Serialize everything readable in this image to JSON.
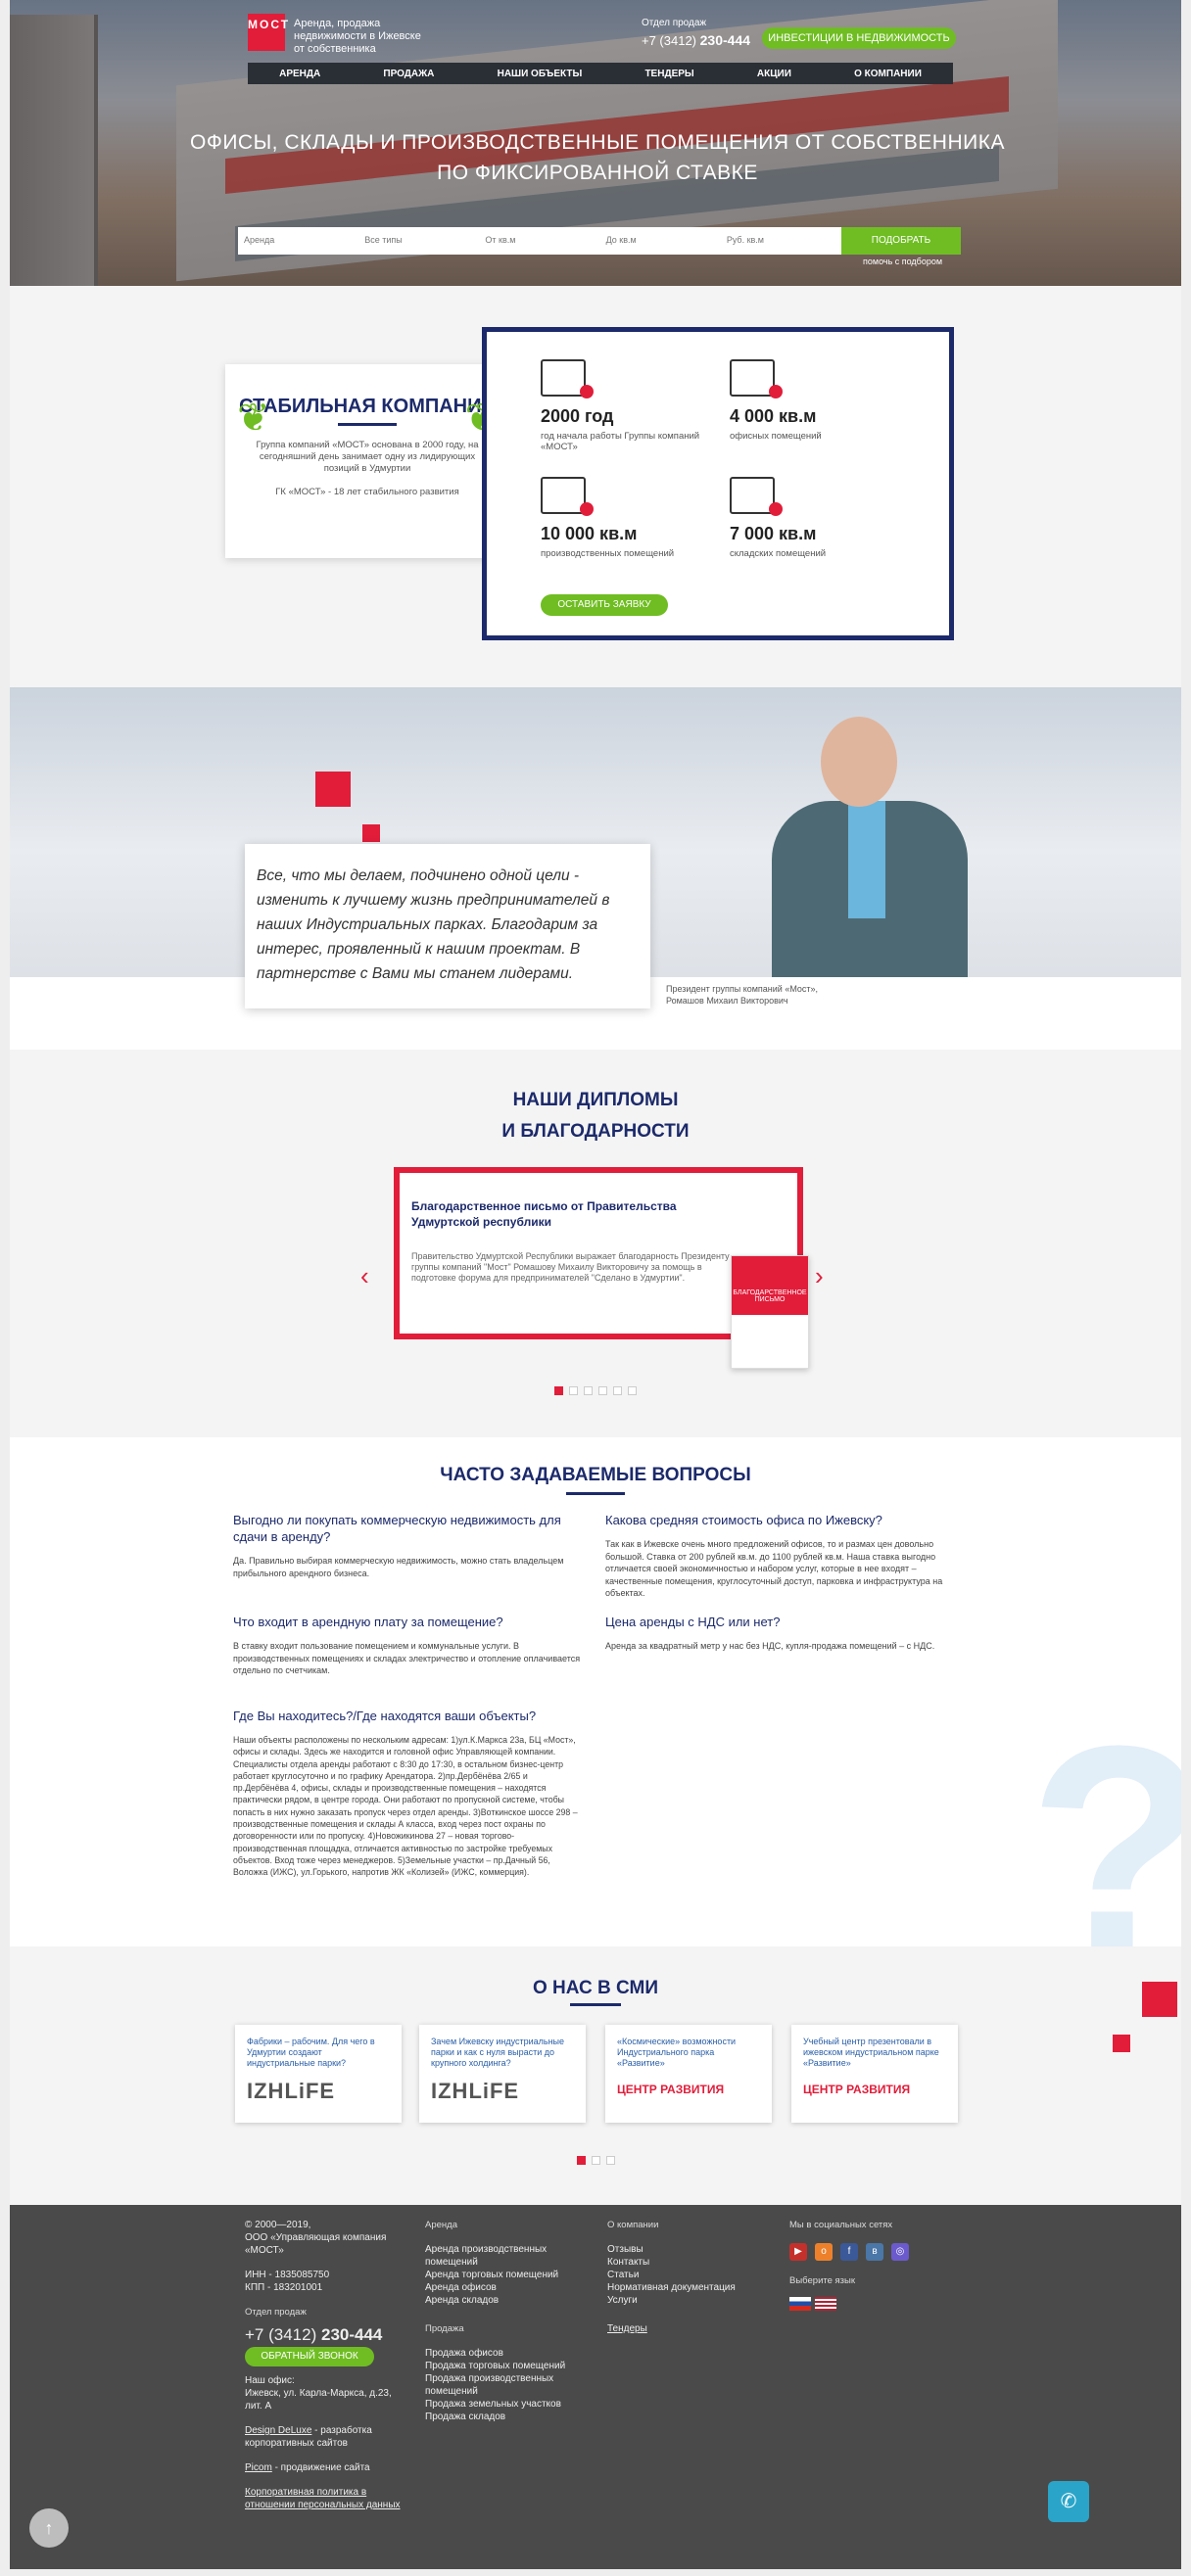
{
  "header": {
    "logo_text": "МОСТ",
    "tagline": "Аренда, продажа недвижимости в Ижевске от собственника",
    "sales_label": "Отдел продаж",
    "phone_prefix": "+7 (3412)",
    "phone_number": "230-444",
    "invest_button": "ИНВЕСТИЦИИ В НЕДВИЖИМОСТЬ",
    "nav": [
      "АРЕНДА",
      "ПРОДАЖА",
      "НАШИ ОБЪЕКТЫ",
      "ТЕНДЕРЫ",
      "АКЦИИ",
      "О КОМПАНИИ"
    ]
  },
  "hero": {
    "title": "ОФИСЫ, СКЛАДЫ И ПРОИЗВОДСТВЕННЫЕ ПОМЕЩЕНИЯ ОТ СОБСТВЕННИКА ПО ФИКСИРОВАННОЙ СТАВКЕ",
    "search_fields": [
      "Аренда",
      "Все типы",
      "От кв.м",
      "До кв.м",
      "Руб. кв.м"
    ],
    "pick_button": "ПОДОБРАТЬ",
    "pick_help": "помочь с подбором"
  },
  "stable": {
    "title": "СТАБИЛЬНАЯ КОМПАНИЯ",
    "text1": "Группа компаний «МОСТ» основана в 2000 году, на сегодняшний день занимает одну из лидирующих позиций в Удмуртии",
    "text2": "ГК «МОСТ» - 18 лет стабильного развития"
  },
  "stats": [
    {
      "value": "2000 год",
      "label": "год начала работы Группы компаний «МОСТ»"
    },
    {
      "value": "4 000 кв.м",
      "label": "офисных помещений"
    },
    {
      "value": "10 000 кв.м",
      "label": "производственных помещений"
    },
    {
      "value": "7 000 кв.м",
      "label": "складских помещений"
    }
  ],
  "stats_button": "ОСТАВИТЬ ЗАЯВКУ",
  "quote": {
    "text": "Все, что мы делаем, подчинено одной цели - изменить к лучшему жизнь предпринимателей в наших Индустриальных парках. Благодарим за интерес, проявленный к нашим проектам. В партнерстве с Вами мы станем лидерами.",
    "caption_role": "Президент группы компаний «Мост»,",
    "caption_name": "Ромашов Михаил Викторович"
  },
  "diplomas": {
    "title1": "НАШИ ДИПЛОМЫ",
    "title2": "И БЛАГОДАРНОСТИ",
    "slide_title": "Благодарственное письмо от Правительства Удмуртской республики",
    "slide_text": "Правительство Удмуртской Республики выражает благодарность Президенту группы компаний \"Мост\" Ромашову Михаилу Викторовичу за помощь в подготовке форума для предпринимателей \"Сделано в Удмуртии\".",
    "doc_label": "БЛАГОДАРСТВЕННОЕ ПИСЬМО",
    "prev": "‹",
    "next": "›"
  },
  "faq": {
    "title": "ЧАСТО ЗАДАВАЕМЫЕ ВОПРОСЫ",
    "items": [
      {
        "q": "Выгодно ли покупать коммерческую недвижимость для сдачи в аренду?",
        "a": "Да. Правильно выбирая коммерческую недвижимость, можно стать владельцем прибыльного арендного бизнеса."
      },
      {
        "q": "Какова средняя стоимость офиса по Ижевску?",
        "a": "Так как в Ижевске очень много предложений офисов, то и размах цен довольно большой. Ставка от 200 рублей кв.м. до 1100 рублей кв.м. Наша ставка выгодно отличается своей экономичностью и набором услуг, которые в нее входят – качественные помещения, круглосуточный доступ, парковка и инфраструктура на объектах."
      },
      {
        "q": "Что входит в арендную плату за помещение?",
        "a": "В ставку входит пользование помещением и коммунальные услуги. В производственных помещениях и складах электричество и отопление оплачивается отдельно по счетчикам."
      },
      {
        "q": "Цена аренды с НДС или нет?",
        "a": "Аренда за квадратный метр у нас без НДС, купля-продажа помещений – с НДС."
      },
      {
        "q": "Где Вы находитесь?/Где находятся ваши объекты?",
        "a": "Наши объекты расположены по нескольким адресам: 1)ул.К.Маркса 23а, БЦ «Мост», офисы и склады. Здесь же находится и головной офис Управляющей компании. Специалисты отдела аренды работают с 8:30 до 17:30, в остальном бизнес-центр работает круглосуточно и по графику Арендатора. 2)пр.Дербёнёва 2/65 и пр.Дербёнёва 4, офисы, склады и производственные помещения – находятся практически рядом, в центре города. Они работают по пропускной системе, чтобы попасть в них нужно заказать пропуск через отдел аренды. 3)Воткинское шоссе 298 – производственные помещения и склады А класса, вход через пост охраны по договоренности или по пропуску. 4)Новожикинова 27 – новая торгово-производственная площадка, отличается активностью по застройке требуемых объектов. Вход тоже через менеджеров. 5)Земельные участки – пр.Дачный 56, Воложка (ИЖС), ул.Горького, напротив ЖК «Колизей» (ИЖС, коммерция)."
      }
    ]
  },
  "media": {
    "title": "О НАС В СМИ",
    "cards": [
      {
        "text": "Фабрики – рабочим. Для чего в Удмуртии создают индустриальные парки?",
        "logo": "IZHLiFE"
      },
      {
        "text": "Зачем Ижевску индустриальные парки и как с нуля вырасти до крупного холдинга?",
        "logo": "IZHLiFE"
      },
      {
        "text": "«Космические» возможности Индустриального парка «Развитие»",
        "logo": "ЦЕНТР РАЗВИТИЯ"
      },
      {
        "text": "Учебный центр презентовали в ижевском индустриальном парке «Развитие»",
        "logo": "ЦЕНТР РАЗВИТИЯ"
      }
    ]
  },
  "footer": {
    "copy": "© 2000—2019,",
    "company": "ООО «Управляющая компания «МОСТ»",
    "inn": "ИНН - 1835085750",
    "kpp": "КПП - 183201001",
    "sales": "Отдел продаж",
    "phone_prefix": "+7 (3412)",
    "phone_number": "230-444",
    "callback": "ОБРАТНЫЙ ЗВОНОК",
    "office_label": "Наш офис:",
    "address": "Ижевск, ул. Карла-Маркса, д.23, лит. А",
    "design_link": "Design DeLuxe",
    "design_text": " - разработка корпоративных сайтов",
    "picom_link": "Picom",
    "picom_text": " - продвижение сайта",
    "policy": "Корпоративная политика в отношении персональных данных",
    "rent_title": "Аренда",
    "rent_links": [
      "Аренда производственных помещений",
      "Аренда торговых помещений",
      "Аренда офисов",
      "Аренда складов"
    ],
    "sale_title": "Продажа",
    "sale_links": [
      "Продажа офисов",
      "Продажа торговых помещений",
      "Продажа производственных помещений",
      "Продажа земельных участков",
      "Продажа складов"
    ],
    "about_title": "О компании",
    "about_links": [
      "Отзывы",
      "Контакты",
      "Статьи",
      "Нормативная документация",
      "Услуги"
    ],
    "tenders": "Тендеры",
    "social_title": "Мы в социальных сетях",
    "lang_title": "Выберите язык",
    "social": [
      "youtube-icon",
      "odnoklassniki-icon",
      "facebook-icon",
      "vk-icon",
      "instagram-icon"
    ]
  }
}
